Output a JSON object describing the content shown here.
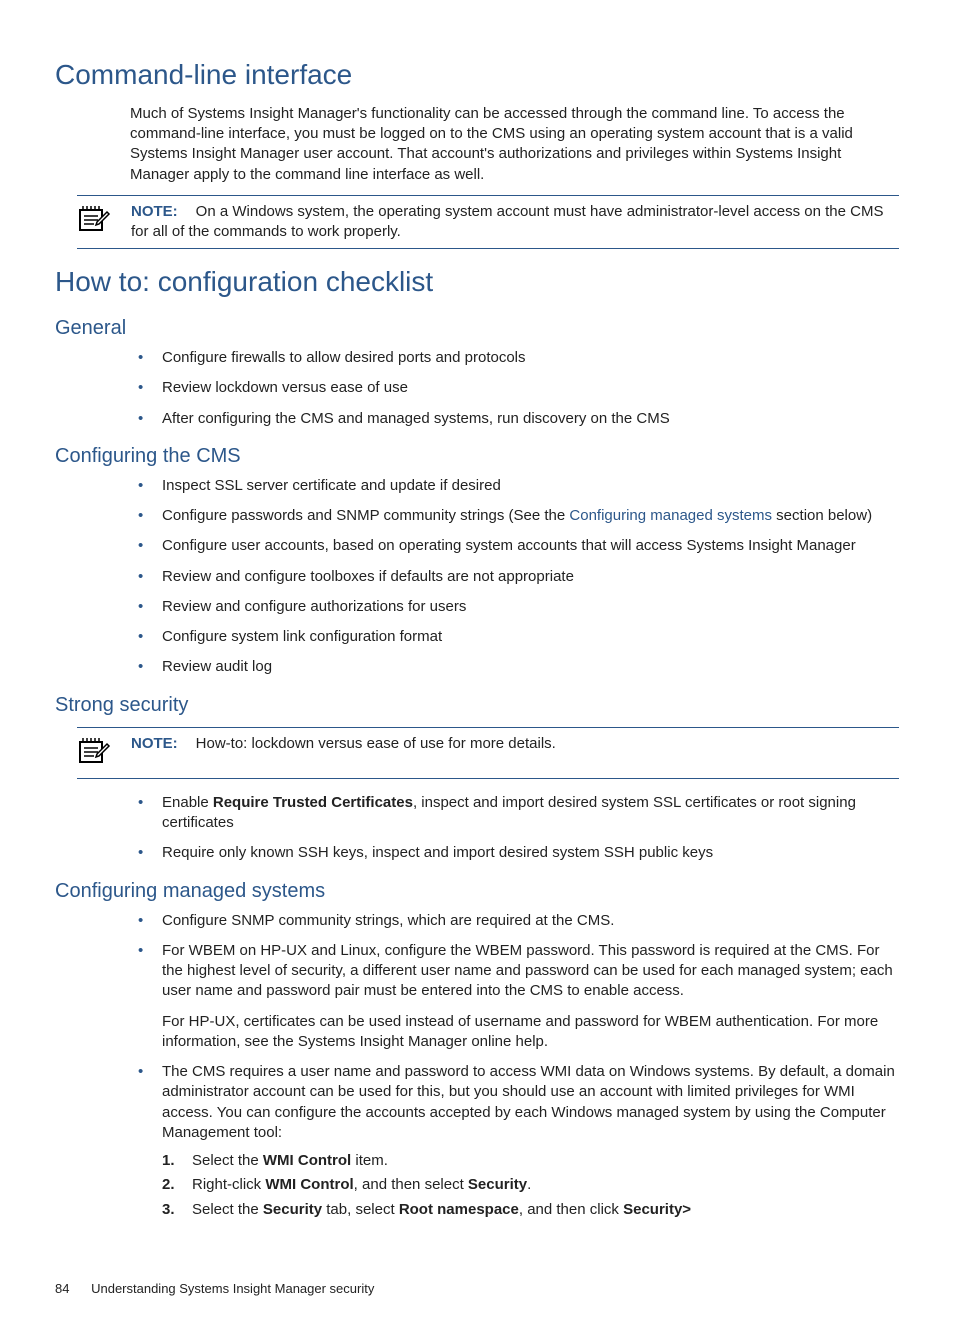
{
  "h1_cli": "Command-line interface",
  "cli_body": "Much of Systems Insight Manager's functionality can be accessed through the command line. To access the command-line interface, you must be logged on to the CMS using an operating system account that is a valid Systems Insight Manager user account. That account's authorizations and privileges within Systems Insight Manager apply to the command line interface as well.",
  "note_label": "NOTE:",
  "note1_text": "On a Windows system, the operating system account must have administrator-level access on the CMS for all of the commands to work properly.",
  "h1_howto": "How to: configuration checklist",
  "h2_general": "General",
  "general_items": {
    "0": "Configure firewalls to allow desired ports and protocols",
    "1": "Review lockdown versus ease of use",
    "2": "After configuring the CMS and managed systems, run discovery on the CMS"
  },
  "h2_cms": "Configuring the CMS",
  "cms_items": {
    "0": "Inspect SSL server certificate and update if desired",
    "1a": "Configure passwords and SNMP community strings (See the ",
    "1link": "Configuring managed systems",
    "1b": " section below)",
    "2": "Configure user accounts, based on operating system accounts that will access Systems Insight Manager",
    "3": "Review and configure toolboxes if defaults are not appropriate",
    "4": "Review and configure authorizations for users",
    "5": "Configure system link configuration format",
    "6": "Review audit log"
  },
  "h2_strong": "Strong security",
  "note2_text": "How-to: lockdown versus ease of use for more details.",
  "strong_items": {
    "0a": "Enable ",
    "0bold": "Require Trusted Certificates",
    "0b": ", inspect and import desired system SSL certificates or root signing certificates",
    "1": "Require only known SSH keys, inspect and import desired system SSH public keys"
  },
  "h2_managed": "Configuring managed systems",
  "managed_items": {
    "0": "Configure SNMP community strings, which are required at the CMS.",
    "1": "For WBEM on HP-UX and Linux, configure the WBEM password. This password is required at the CMS. For the highest level of security, a different user name and password can be used for each managed system; each user name and password pair must be entered into the CMS to enable access.",
    "1p2": "For HP-UX, certificates can be used instead of username and password for WBEM authentication. For more information, see the Systems Insight Manager online help.",
    "2": "The CMS requires a user name and password to access WMI data on Windows systems. By default, a domain administrator account can be used for this, but you should use an account with limited privileges for WMI access. You can configure the accounts accepted by each Windows managed system by using the Computer Management tool:"
  },
  "steps": {
    "0a": "Select the ",
    "0bold": "WMI Control",
    "0b": " item.",
    "1a": "Right-click ",
    "1bold1": "WMI Control",
    "1b": ", and then select ",
    "1bold2": "Security",
    "1c": ".",
    "2a": "Select the ",
    "2bold1": "Security",
    "2b": " tab, select ",
    "2bold2": "Root namespace",
    "2c": ", and then click ",
    "2bold3": "Security>"
  },
  "footer_page": "84",
  "footer_title": "Understanding Systems Insight Manager security"
}
